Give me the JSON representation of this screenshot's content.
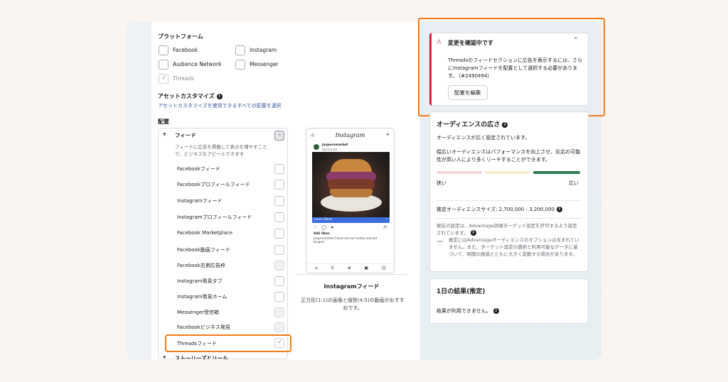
{
  "platforms": {
    "title": "プラットフォーム",
    "facebook": "Facebook",
    "instagram": "Instagram",
    "audience_network": "Audience Network",
    "messenger": "Messenger",
    "threads": "Threads"
  },
  "asset_customize": {
    "title": "アセットカスタマイズ",
    "link": "アセットカスタマイズを使用できるすべての配置を選択"
  },
  "placement": {
    "title": "配置",
    "group_title": "フィード",
    "group_desc": "フィードに広告を掲載して表示を増やすことで、ビジネスをアピールできます",
    "items": [
      "Facebookフィード",
      "Facebookプロフィールフィード",
      "Instagramフィード",
      "Instagramプロフィールフィード",
      "Facebook Marketplace",
      "Facebook動画フィード",
      "Facebook右側広告枠",
      "Instagram発見タブ",
      "Instagram発見ホーム",
      "Messenger受信箱",
      "Facebookビジネス発見",
      "Threadsフィード"
    ],
    "next_group": "ストーリーズとリール"
  },
  "preview": {
    "app_name": "Instagram",
    "account": "jaspersmarket",
    "sponsored": "Sponsored",
    "cta": "Learn More",
    "likes": "846 likes",
    "caption": "jaspersmarket Check out our locally sourced burgers",
    "title": "Instagramフィード",
    "desc": "正方形(1:1)の画像と縦型(4:5)の動画がおすすめです。"
  },
  "alert": {
    "title": "変更を確認中です",
    "text": "Threadsのフィードセクションに広告を表示するには、さらにInstagramフィードを配置として選択する必要があります。 (#2490494)",
    "button": "配置を編集"
  },
  "audience": {
    "title": "オーディエンスの広さ",
    "status": "オーディエンスが広く設定されています。",
    "desc": "幅広いオーディエンスはパフォーマンスを向上させ、反応の可能性が高い人により多くリーチすることができます。",
    "narrow": "狭い",
    "broad": "広い",
    "size_label": "推定オーディエンスサイズ: 2,700,000 - 3,200,000",
    "note1": "現在の設定は、Advantage詳細ターゲット設定を許可するよう設定されています。",
    "note2": "推定にはAdvantageオーディエンスのオプションは含まれていません。また、ターゲット設定の選択と利用可能なデータに基づいて、時間の経過とともに大きく変動する場合があります。",
    "colors": {
      "narrow": "#f6d4d7",
      "mid": "#f3efd1",
      "broad": "#2f7d53"
    }
  },
  "daily": {
    "title": "1日の結果(推定)",
    "text": "結果が利用できません。"
  }
}
